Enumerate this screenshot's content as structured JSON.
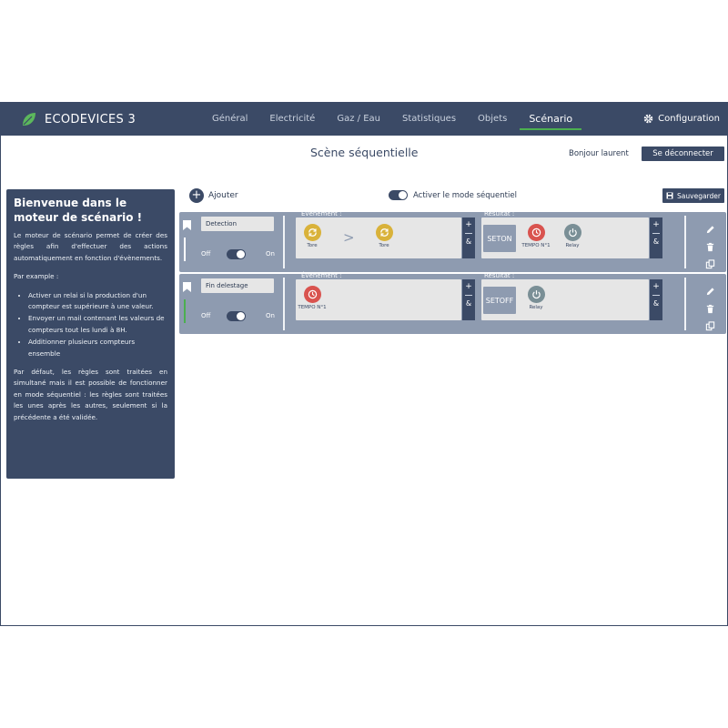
{
  "app": {
    "name": "ECODEVICES 3",
    "config_label": "Configuration"
  },
  "nav": [
    {
      "label": "Général"
    },
    {
      "label": "Electricité"
    },
    {
      "label": "Gaz / Eau"
    },
    {
      "label": "Statistiques"
    },
    {
      "label": "Objets"
    },
    {
      "label": "Scénario"
    }
  ],
  "header": {
    "title": "Scène séquentielle",
    "greeting": "Bonjour laurent",
    "logout_label": "Se déconnecter"
  },
  "welcome": {
    "title": "Bienvenue dans le moteur de scénario !",
    "intro": "Le moteur de scénario permet de créer des règles afin d'effectuer des actions automatiquement en fonction d'évènements.",
    "example_heading": "Par example :",
    "examples": [
      "Activer un relai si la production d'un compteur est supérieure à une valeur.",
      "Envoyer un mail contenant les valeurs de compteurs tout les lundi à 8H.",
      "Additionner plusieurs compteurs ensemble"
    ],
    "footer": "Par défaut, les règles sont traitées en simultané mais il est possible de fonctionner en mode séquentiel : les règles sont traitées les unes après les autres, seulement si la précédente a été validée."
  },
  "toolbar": {
    "add_label": "Ajouter",
    "sequential_label": "Activer le mode séquentiel",
    "save_label": "Sauvegarder"
  },
  "common": {
    "event_label": "Évènement :",
    "result_label": "Résultat :",
    "off": "Off",
    "on": "On",
    "plus": "+",
    "amp": "&"
  },
  "rules": [
    {
      "name": "Detection",
      "events": [
        {
          "label": "Tore",
          "color": "#d9b23a",
          "icon": "sync-icon"
        },
        {
          "label": "Tore",
          "color": "#d9b23a",
          "icon": "sync-icon"
        }
      ],
      "arrow": ">",
      "action": "SETON",
      "results": [
        {
          "label": "TEMPO N°1",
          "color": "#d9534f",
          "icon": "clock-icon"
        },
        {
          "label": "Relay",
          "color": "#7a8f96",
          "icon": "power-icon"
        }
      ]
    },
    {
      "name": "Fin delestage",
      "events": [
        {
          "label": "TEMPO N°1",
          "color": "#d9534f",
          "icon": "clock-icon"
        }
      ],
      "action": "SETOFF",
      "results": [
        {
          "label": "Relay",
          "color": "#7a8f96",
          "icon": "power-icon"
        }
      ]
    }
  ]
}
